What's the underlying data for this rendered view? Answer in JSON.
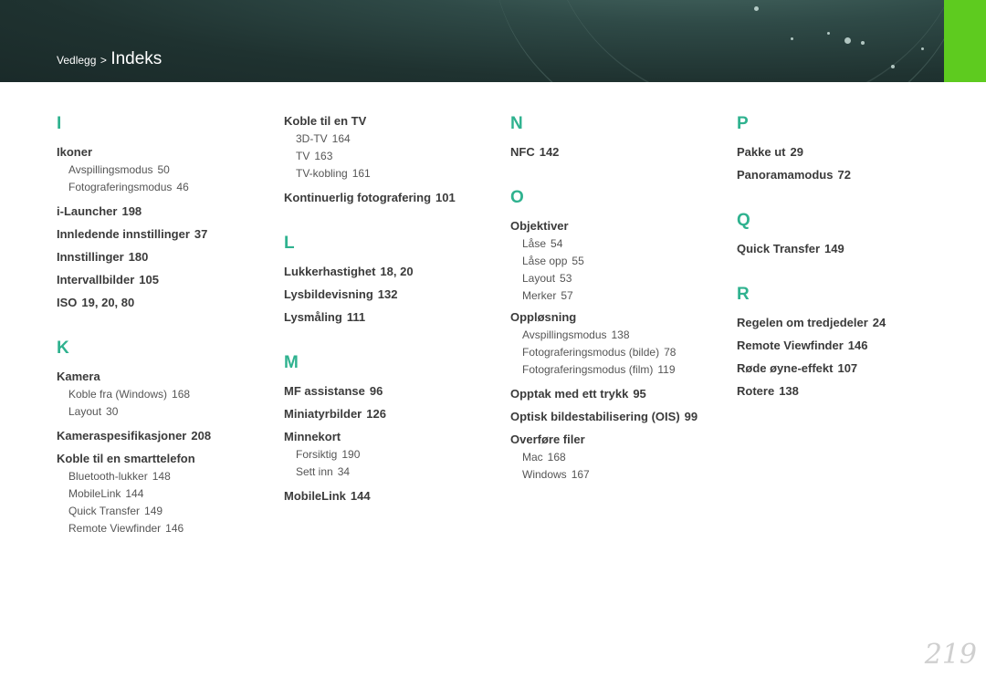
{
  "header": {
    "breadcrumb_parent": "Vedlegg",
    "separator": ">",
    "breadcrumb_current": "Indeks",
    "accent_color": "#5ecb1f"
  },
  "index": {
    "I": {
      "letter": "I",
      "ikoner": {
        "term": "Ikoner",
        "subs": [
          {
            "label": "Avspillingsmodus",
            "page": "50"
          },
          {
            "label": "Fotograferingsmodus",
            "page": "46"
          }
        ]
      },
      "entries": [
        {
          "term": "i-Launcher",
          "page": "198"
        },
        {
          "term": "Innledende innstillinger",
          "page": "37"
        },
        {
          "term": "Innstillinger",
          "page": "180"
        },
        {
          "term": "Intervallbilder",
          "page": "105"
        },
        {
          "term": "ISO",
          "page": "19, 20, 80"
        }
      ],
      "koble_tv": {
        "term": "Koble til en TV",
        "subs": [
          {
            "label": "3D-TV",
            "page": "164"
          },
          {
            "label": "TV",
            "page": "163"
          },
          {
            "label": "TV-kobling",
            "page": "161"
          }
        ]
      },
      "kontinuerlig": {
        "term": "Kontinuerlig fotografering",
        "page": "101"
      }
    },
    "K": {
      "letter": "K",
      "kamera": {
        "term": "Kamera",
        "subs": [
          {
            "label": "Koble fra (Windows)",
            "page": "168"
          },
          {
            "label": "Layout",
            "page": "30"
          }
        ]
      },
      "kameraspes": {
        "term": "Kameraspesifikasjoner",
        "page": "208"
      },
      "koble_smart": {
        "term": "Koble til en smarttelefon",
        "subs": [
          {
            "label": "Bluetooth-lukker",
            "page": "148"
          },
          {
            "label": "MobileLink",
            "page": "144"
          },
          {
            "label": "Quick Transfer",
            "page": "149"
          },
          {
            "label": "Remote Viewfinder",
            "page": "146"
          }
        ]
      }
    },
    "L": {
      "letter": "L",
      "entries": [
        {
          "term": "Lukkerhastighet",
          "page": "18, 20"
        },
        {
          "term": "Lysbildevisning",
          "page": "132"
        },
        {
          "term": "Lysmåling",
          "page": "111"
        }
      ]
    },
    "M": {
      "letter": "M",
      "entries": [
        {
          "term": "MF assistanse",
          "page": "96"
        },
        {
          "term": "Miniatyrbilder",
          "page": "126"
        }
      ],
      "minnekort": {
        "term": "Minnekort",
        "subs": [
          {
            "label": "Forsiktig",
            "page": "190"
          },
          {
            "label": "Sett inn",
            "page": "34"
          }
        ]
      },
      "mobilelink": {
        "term": "MobileLink",
        "page": "144"
      }
    },
    "N": {
      "letter": "N",
      "entries": [
        {
          "term": "NFC",
          "page": "142"
        }
      ]
    },
    "O": {
      "letter": "O",
      "objektiver": {
        "term": "Objektiver",
        "subs": [
          {
            "label": "Låse",
            "page": "54"
          },
          {
            "label": "Låse opp",
            "page": "55"
          },
          {
            "label": "Layout",
            "page": "53"
          },
          {
            "label": "Merker",
            "page": "57"
          }
        ]
      },
      "opplosning": {
        "term": "Oppløsning",
        "subs": [
          {
            "label": "Avspillingsmodus",
            "page": "138"
          },
          {
            "label": "Fotograferingsmodus (bilde)",
            "page": "78"
          },
          {
            "label": "Fotograferingsmodus (film)",
            "page": "119"
          }
        ]
      },
      "entries": [
        {
          "term": "Opptak med ett trykk",
          "page": "95"
        },
        {
          "term": "Optisk bildestabilisering (OIS)",
          "page": "99"
        }
      ],
      "overfore": {
        "term": "Overføre filer",
        "subs": [
          {
            "label": "Mac",
            "page": "168"
          },
          {
            "label": "Windows",
            "page": "167"
          }
        ]
      }
    },
    "P": {
      "letter": "P",
      "entries": [
        {
          "term": "Pakke ut",
          "page": "29"
        },
        {
          "term": "Panoramamodus",
          "page": "72"
        }
      ]
    },
    "Q": {
      "letter": "Q",
      "entries": [
        {
          "term": "Quick Transfer",
          "page": "149"
        }
      ]
    },
    "R": {
      "letter": "R",
      "entries": [
        {
          "term": "Regelen om tredjedeler",
          "page": "24"
        },
        {
          "term": "Remote Viewfinder",
          "page": "146"
        },
        {
          "term": "Røde øyne-effekt",
          "page": "107"
        },
        {
          "term": "Rotere",
          "page": "138"
        }
      ]
    }
  },
  "page_number": "219"
}
